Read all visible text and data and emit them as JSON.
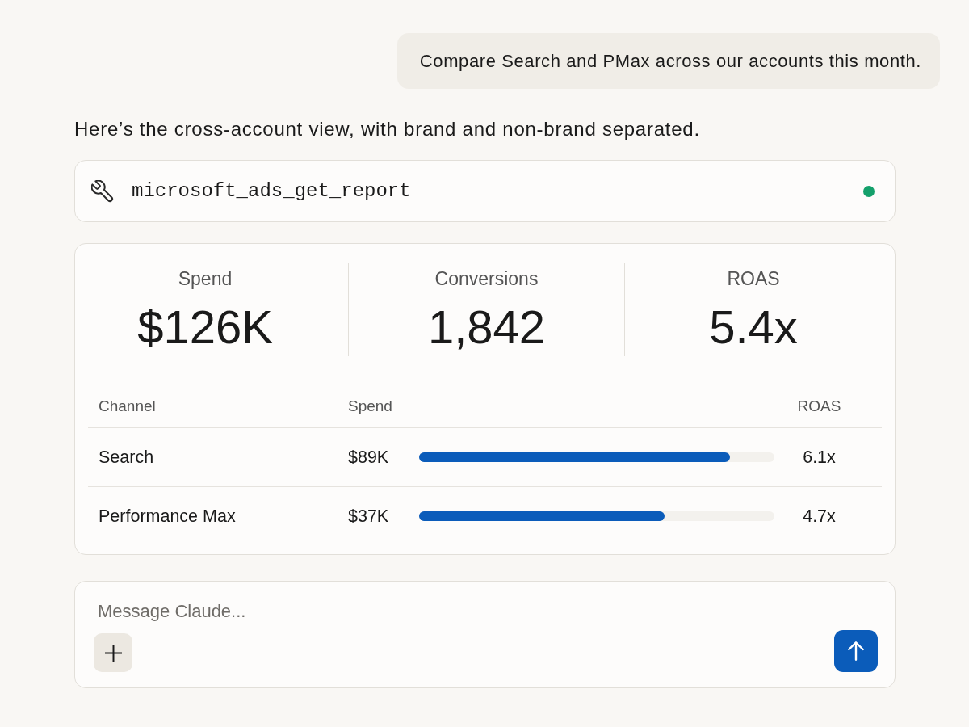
{
  "user_message": {
    "text": "Compare Search and PMax across our accounts this month."
  },
  "assistant_message": {
    "text": "Here’s the cross-account view, with brand and non-brand separated."
  },
  "tool_call": {
    "name": "microsoft_ads_get_report",
    "complete": true
  },
  "summary": {
    "stats": [
      {
        "label": "Spend",
        "value": "$126K"
      },
      {
        "label": "Conversions",
        "value": "1,842"
      },
      {
        "label": "ROAS",
        "value": "5.4x"
      }
    ],
    "table": {
      "columns": [
        "Channel",
        "Spend",
        "ROAS"
      ],
      "rows": [
        {
          "channel": "Search",
          "spend": "$89K",
          "level": 0.875,
          "roas": "6.1x"
        },
        {
          "channel": "Performance Max",
          "spend": "$37K",
          "level": 0.69,
          "roas": "4.7x"
        }
      ]
    }
  },
  "composer": {
    "placeholder": "Message Claude..."
  }
}
